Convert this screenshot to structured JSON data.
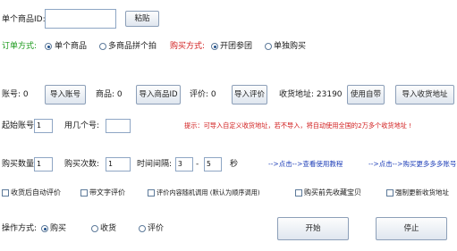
{
  "row1": {
    "label": "单个商品ID:",
    "input_value": "",
    "paste_button": "粘贴"
  },
  "row2": {
    "label": "订单方式:",
    "opt_single": "单个商品",
    "opt_multi": "多商品拼个拍",
    "buy_label": "购买方式:",
    "opt_group": "开团参团",
    "opt_solo": "单独购买"
  },
  "row3": {
    "account_label": "账号: 0",
    "import_account_btn": "导入账号",
    "product_label": "商品: 0",
    "import_product_btn": "导入商品ID",
    "review_label": "评价: 0",
    "import_review_btn": "导入评价",
    "address_label": "收货地址: 23190",
    "use_own_btn": "使用自带",
    "import_address_btn": "导入收货地址"
  },
  "row4": {
    "start_label": "起始账号:",
    "start_value": "1",
    "nth_label": "用几个号:",
    "nth_value": "",
    "tip": "提示：可导入自定义收货地址，若不导入，将自动使用全国的2万多个收货地址 !"
  },
  "row5": {
    "qty_label": "购买数量:",
    "qty_value": "1",
    "times_label": "购买次数:",
    "times_value": "1",
    "interval_label": "时间间隔:",
    "interval_from": "3",
    "interval_to": "5",
    "seconds": "秒",
    "tutorial_link": "-->点击-->查看使用教程",
    "more_link": "-->点击-->购买更多多多账号"
  },
  "row6": {
    "cb1": "收货后自动评价",
    "cb2": "带文字评价",
    "cb3": "评价内容随机调用 (默认为顺序调用)",
    "cb4": "购买前先收藏宝贝",
    "cb5": "强制更新收货地址"
  },
  "row7": {
    "label": "操作方式:",
    "opt_buy": "购买",
    "opt_receive": "收货",
    "opt_review": "评价",
    "start_btn": "开始",
    "stop_btn": "停止"
  }
}
